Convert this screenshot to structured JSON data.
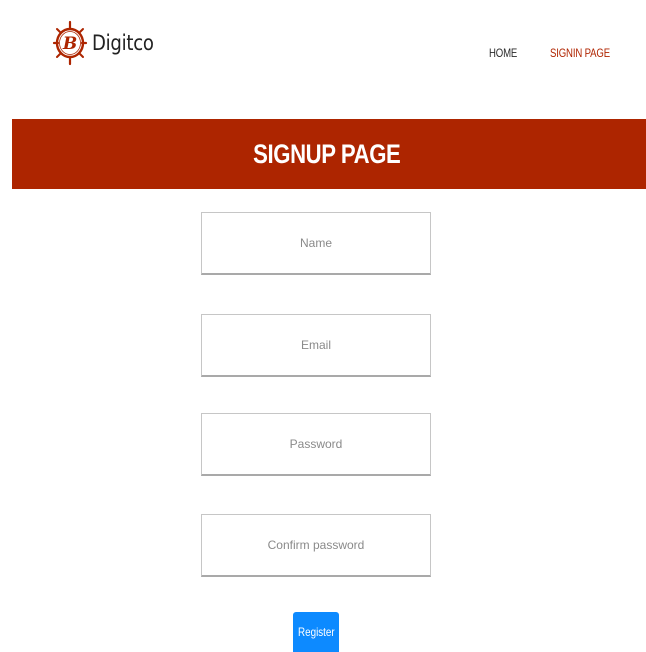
{
  "brand": {
    "name": "Digitco",
    "logo_icon": "ship-wheel-b-logo",
    "logo_letter": "B",
    "accent_color": "#ad2500"
  },
  "nav": {
    "items": [
      {
        "label": "HOME",
        "active": false
      },
      {
        "label": "SIGNIN PAGE",
        "active": true
      }
    ]
  },
  "banner": {
    "title": "SIGNUP PAGE",
    "background_color": "#ad2500"
  },
  "form": {
    "fields": [
      {
        "placeholder": "Name",
        "value": "",
        "type": "text"
      },
      {
        "placeholder": "Email",
        "value": "",
        "type": "email"
      },
      {
        "placeholder": "Password",
        "value": "",
        "type": "password"
      },
      {
        "placeholder": "Confirm password",
        "value": "",
        "type": "password"
      }
    ],
    "submit_label": "Register",
    "submit_color": "#0d8aff"
  }
}
